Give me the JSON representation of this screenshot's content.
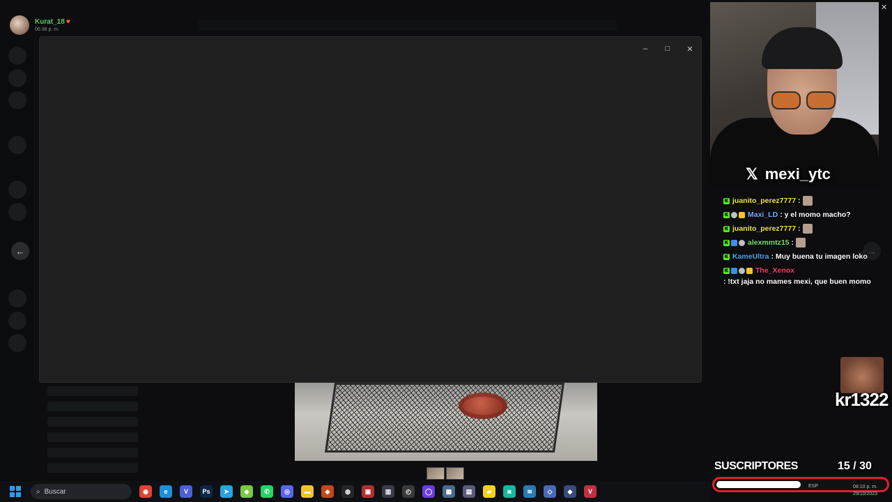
{
  "viewer": {
    "author": "Kurat_18",
    "time": "06:38 p. m."
  },
  "window_controls": {
    "minimize": "–",
    "maximize": "□",
    "close": "✕"
  },
  "nav": {
    "prev": "←",
    "next": "→"
  },
  "stream": {
    "handle": "mexi_ytc",
    "close": "✕"
  },
  "chat": [
    {
      "user": "juanito_perez7777",
      "color": "#f4e542",
      "badges": [
        "k"
      ],
      "text": ":",
      "emote": true
    },
    {
      "user": "Maxi_LD",
      "color": "#79a8ff",
      "badges": [
        "k",
        "m",
        "c"
      ],
      "text": ": y el momo macho?",
      "emote": false
    },
    {
      "user": "juanito_perez7777",
      "color": "#f4e542",
      "badges": [
        "k"
      ],
      "text": ":",
      "emote": true
    },
    {
      "user": "alexmmtz15",
      "color": "#6ce36c",
      "badges": [
        "k",
        "b",
        "m"
      ],
      "text": ":",
      "emote": true
    },
    {
      "user": "KameUltra",
      "color": "#4aa3f0",
      "badges": [
        "k"
      ],
      "text": ": Muy buena tu imagen loko",
      "emote": false
    },
    {
      "user": "The_Xenox",
      "color": "#ff3b6b",
      "badges": [
        "k",
        "b",
        "m",
        "c"
      ],
      "text": ": !txt jaja no mames mexi, que buen momo",
      "emote": false
    }
  ],
  "subs": {
    "latest": "kr1322",
    "label": "SUSCRIPTORES",
    "count_text": "15  / 30",
    "progress": 0.5
  },
  "taskbar": {
    "search_placeholder": "Buscar",
    "apps": [
      {
        "name": "chrome-icon",
        "glyph": "◉",
        "color": "#db4437"
      },
      {
        "name": "edge-icon",
        "glyph": "e",
        "color": "#1f8fd6"
      },
      {
        "name": "vivaldi-icon",
        "glyph": "V",
        "color": "#4c5fd6"
      },
      {
        "name": "photoshop-icon",
        "glyph": "Ps",
        "color": "#0a2745"
      },
      {
        "name": "telegram-icon",
        "glyph": "➤",
        "color": "#2aa3df"
      },
      {
        "name": "android-icon",
        "glyph": "◆",
        "color": "#7ac943"
      },
      {
        "name": "whatsapp-icon",
        "glyph": "✆",
        "color": "#25d366"
      },
      {
        "name": "discord-icon",
        "glyph": "◎",
        "color": "#5865f2"
      },
      {
        "name": "folder-icon",
        "glyph": "▬",
        "color": "#f2c230"
      },
      {
        "name": "game-icon",
        "glyph": "◈",
        "color": "#c04a1a"
      },
      {
        "name": "obs-icon",
        "glyph": "◍",
        "color": "#262626"
      },
      {
        "name": "app-icon",
        "glyph": "▣",
        "color": "#b03030"
      },
      {
        "name": "audio-icon",
        "glyph": "▥",
        "color": "#3a3a4a"
      },
      {
        "name": "clock-app-icon",
        "glyph": "◴",
        "color": "#3a3a3a"
      },
      {
        "name": "record-icon",
        "glyph": "◯",
        "color": "#6a3ce0"
      },
      {
        "name": "image-icon",
        "glyph": "▦",
        "color": "#4a6a8a"
      },
      {
        "name": "editor-icon",
        "glyph": "▤",
        "color": "#5a5a7a"
      },
      {
        "name": "sticky-icon",
        "glyph": "▰",
        "color": "#f5d020"
      },
      {
        "name": "controller-icon",
        "glyph": "◙",
        "color": "#18b8a0"
      },
      {
        "name": "fish-icon",
        "glyph": "≋",
        "color": "#2a7ab8"
      },
      {
        "name": "diamond-icon",
        "glyph": "◇",
        "color": "#4a6ab8"
      },
      {
        "name": "tool-icon",
        "glyph": "◆",
        "color": "#3a4a7a"
      },
      {
        "name": "valorant-icon",
        "glyph": "V",
        "color": "#c03040"
      }
    ],
    "tray": "ESP",
    "clock_time": "08:10 p. m.",
    "clock_date": "29/10/2023"
  }
}
